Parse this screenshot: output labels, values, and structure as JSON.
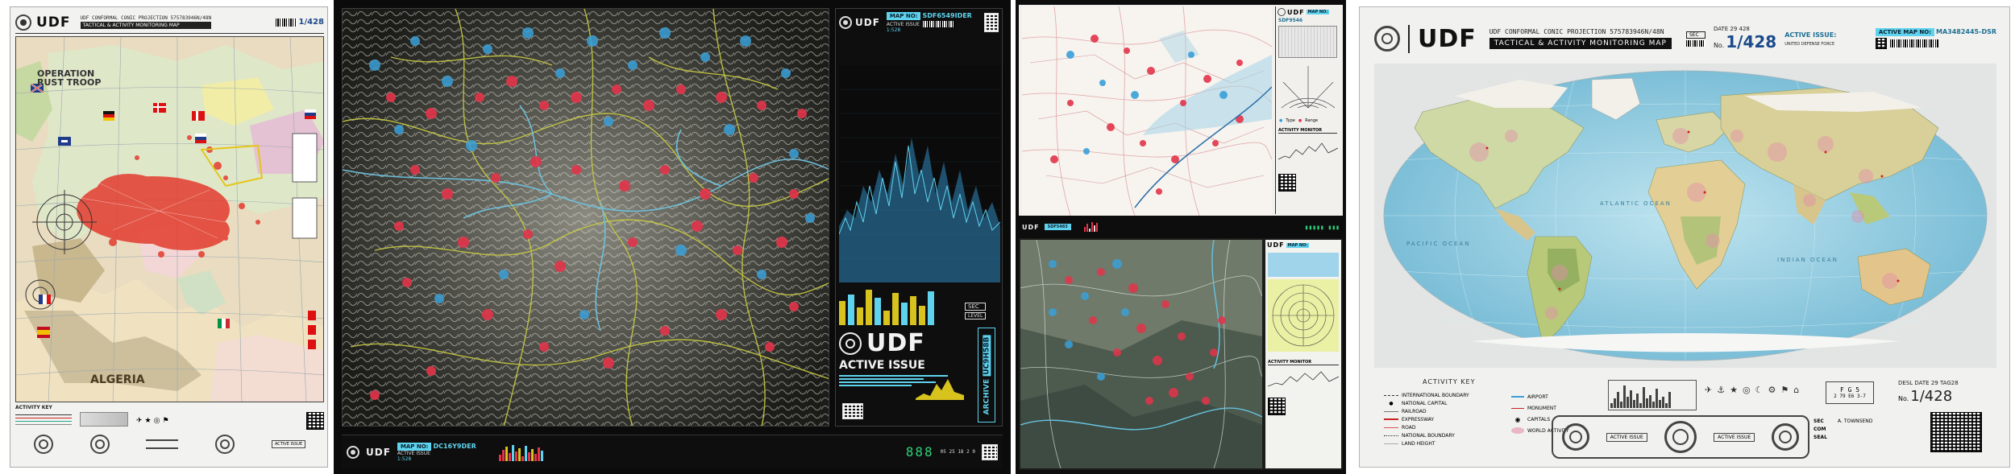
{
  "panel1": {
    "brand": "UDF",
    "subtitle": "UDF CONFORMAL CONIC PROJECTION 575783946N/48N",
    "title": "TACTICAL & ACTIVITY MONITORING MAP",
    "scale": "1/428",
    "operation_label": "OPERATION",
    "operation_name": "RUST TROOP",
    "region_label": "ALGERIA",
    "activity_key": "ACTIVITY KEY",
    "active_issue": "ACTIVE ISSUE"
  },
  "panel2": {
    "brand": "UDF",
    "map_no_label": "MAP NO:",
    "map_no_value": "SDF6549IDER",
    "active_issue_small": "ACTIVE ISSUE",
    "scale_small": "1:528",
    "logo": "UDF",
    "active_issue": "ACTIVE ISSUE",
    "archive_label": "ARCHIVE",
    "archive_value": "UC9H58B",
    "sec_label": "SEC",
    "sec_value": "LEVEL",
    "bottom_map_no_label": "MAP NO:",
    "bottom_map_no_value": "DC16Y9DER",
    "bottom_active": "ACTIVE ISSUE",
    "bottom_scale": "1:528",
    "counter": "888",
    "footer_code": "05 25 18 2 0"
  },
  "panel3": {
    "brand": "UDF",
    "map_no_label": "MAP NO:",
    "map_no_value": "SDF9546",
    "activity_monitor": "ACTIVITY MONITOR",
    "bottom_map_no_value": "SDF5483",
    "legend_label_1": "Type",
    "legend_label_2": "Range"
  },
  "panel4": {
    "brand": "UDF",
    "projection": "UDF CONFORMAL CONIC PROJECTION 575783946N/48N",
    "title": "TACTICAL & ACTIVITY MONITORING MAP",
    "sec_label": "SEC",
    "issue_label": "DATE 29 428",
    "scale_prefix": "No.",
    "scale_value": "1/428",
    "active_issue_label": "ACTIVE ISSUE:",
    "active_map_label": "ACTIVE MAP NO:",
    "active_map_value": "MA3482445-DSR",
    "defense_force": "UNITED DEFENSE FORCE",
    "activity_key": "ACTIVITY KEY",
    "key_left": [
      "INTERNATIONAL BOUNDARY",
      "NATIONAL CAPITAL",
      "RAILROAD",
      "EXPRESSWAY",
      "ROAD",
      "NATIONAL BOUNDARY",
      "LAND HEIGHT"
    ],
    "key_right": [
      "AIRPORT",
      "MONUMENT",
      "CAPITALS",
      "WORLD ACTIVITY"
    ],
    "date_code": "DESL DATE 29 TAG28",
    "scale_bottom": "1/428",
    "sec_small": "SEC",
    "com_small": "COM",
    "seal_small": "SEAL",
    "signed_small": "A. TOWNSEND",
    "stamp_text": "ACTIVE ISSUE",
    "ocean_label": "PACIFIC OCEAN",
    "ocean_label_2": "ATLANTIC OCEAN",
    "ocean_label_3": "INDIAN OCEAN",
    "grid_code": "F G 5",
    "grid_code_2": "2 79 E6 3-7"
  }
}
